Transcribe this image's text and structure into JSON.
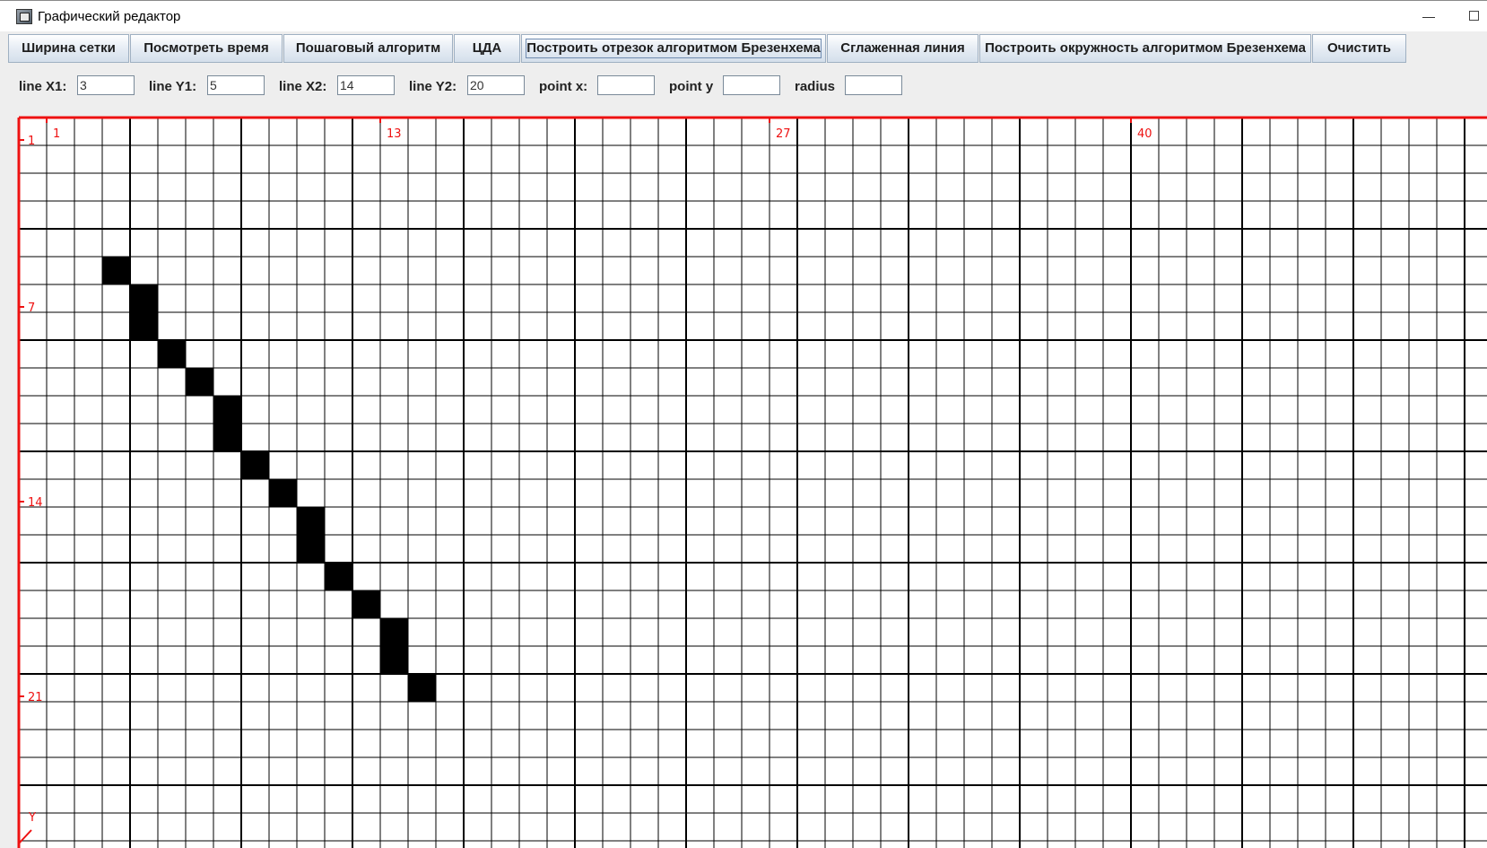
{
  "window": {
    "title": "Графический редактор"
  },
  "toolbar": {
    "buttons": [
      "Ширина сетки",
      "Посмотреть время",
      "Пошаговый алгоритм",
      "ЦДА",
      "Построить отрезок алгоритмом Брезенхема",
      "Сглаженная линия",
      "Построить окружность алгоритмом Брезенхема",
      "Очистить"
    ]
  },
  "params": {
    "line_x1": {
      "label": "line X1:",
      "value": "3"
    },
    "line_y1": {
      "label": "line Y1:",
      "value": "5"
    },
    "line_x2": {
      "label": "line X2:",
      "value": "14"
    },
    "line_y2": {
      "label": "line Y2:",
      "value": "20"
    },
    "point_x": {
      "label": "point x:",
      "value": ""
    },
    "point_y": {
      "label": "point y",
      "value": ""
    },
    "radius": {
      "label": "radius",
      "value": ""
    }
  },
  "grid": {
    "columns_visible": 52,
    "rows_visible": 26,
    "x_tick_labels": [
      "1",
      "13",
      "27",
      "40"
    ],
    "y_tick_labels": [
      "1",
      "7",
      "14",
      "21"
    ],
    "y_axis_letter": "Y",
    "plotted_cells": [
      [
        4,
        6
      ],
      [
        5,
        7
      ],
      [
        5,
        8
      ],
      [
        6,
        9
      ],
      [
        7,
        10
      ],
      [
        8,
        11
      ],
      [
        8,
        12
      ],
      [
        9,
        13
      ],
      [
        10,
        14
      ],
      [
        11,
        15
      ],
      [
        11,
        16
      ],
      [
        12,
        17
      ],
      [
        13,
        18
      ],
      [
        14,
        19
      ],
      [
        14,
        20
      ],
      [
        15,
        21
      ]
    ],
    "colors": {
      "axis": "#ee1111",
      "grid": "#000000",
      "cell": "#000000",
      "background": "#ffffff"
    }
  }
}
